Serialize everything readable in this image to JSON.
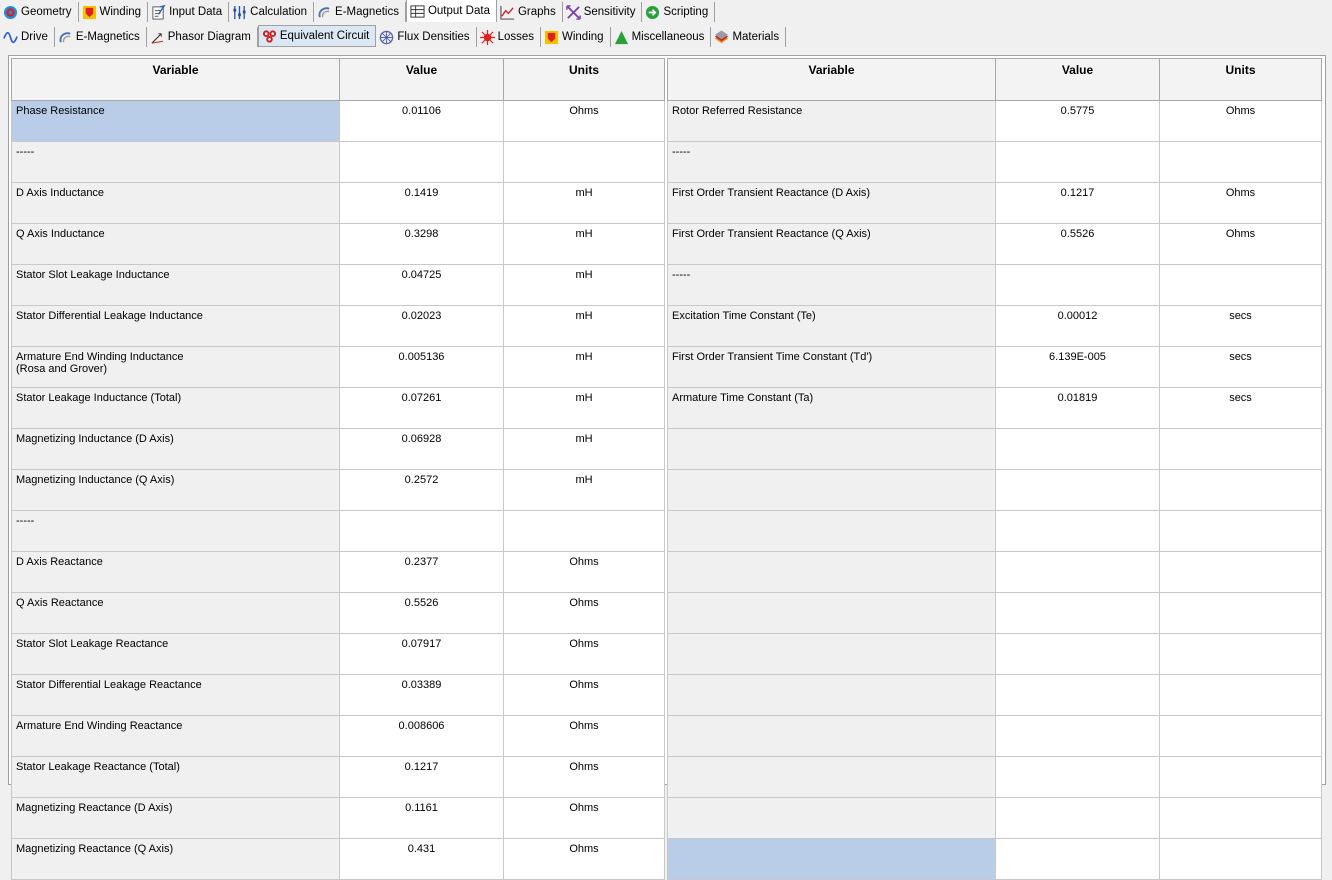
{
  "main_tabs": [
    {
      "label": "Geometry",
      "icon": "geometry-icon"
    },
    {
      "label": "Winding",
      "icon": "winding-icon"
    },
    {
      "label": "Input Data",
      "icon": "input-data-icon"
    },
    {
      "label": "Calculation",
      "icon": "calculation-icon"
    },
    {
      "label": "E-Magnetics",
      "icon": "e-magnetics-icon"
    },
    {
      "label": "Output Data",
      "icon": "output-data-icon",
      "active": true
    },
    {
      "label": "Graphs",
      "icon": "graphs-icon"
    },
    {
      "label": "Sensitivity",
      "icon": "sensitivity-icon"
    },
    {
      "label": "Scripting",
      "icon": "scripting-icon"
    }
  ],
  "sub_tabs": [
    {
      "label": "Drive",
      "icon": "drive-icon"
    },
    {
      "label": "E-Magnetics",
      "icon": "e-magnetics-icon"
    },
    {
      "label": "Phasor Diagram",
      "icon": "phasor-diagram-icon"
    },
    {
      "label": "Equivalent Circuit",
      "icon": "equivalent-circuit-icon",
      "active": true
    },
    {
      "label": "Flux Densities",
      "icon": "flux-densities-icon"
    },
    {
      "label": "Losses",
      "icon": "losses-icon"
    },
    {
      "label": "Winding",
      "icon": "winding-icon"
    },
    {
      "label": "Miscellaneous",
      "icon": "miscellaneous-icon"
    },
    {
      "label": "Materials",
      "icon": "materials-icon"
    }
  ],
  "left_table": {
    "headers": {
      "variable": "Variable",
      "value": "Value",
      "units": "Units"
    },
    "rows": [
      {
        "variable": "Phase Resistance",
        "value": "0.01106",
        "units": "Ohms",
        "selected": true
      },
      {
        "variable": "-----",
        "value": "",
        "units": ""
      },
      {
        "variable": "D Axis Inductance",
        "value": "0.1419",
        "units": "mH"
      },
      {
        "variable": "Q Axis Inductance",
        "value": "0.3298",
        "units": "mH"
      },
      {
        "variable": "Stator Slot Leakage Inductance",
        "value": "0.04725",
        "units": "mH"
      },
      {
        "variable": "Stator Differential Leakage Inductance",
        "value": "0.02023",
        "units": "mH"
      },
      {
        "variable": "Armature End Winding Inductance",
        "variable_line2": "(Rosa and Grover)",
        "value": "0.005136",
        "units": "mH"
      },
      {
        "variable": "Stator Leakage Inductance (Total)",
        "value": "0.07261",
        "units": "mH"
      },
      {
        "variable": "Magnetizing Inductance (D Axis)",
        "value": "0.06928",
        "units": "mH"
      },
      {
        "variable": "Magnetizing Inductance (Q Axis)",
        "value": "0.2572",
        "units": "mH"
      },
      {
        "variable": "-----",
        "value": "",
        "units": ""
      },
      {
        "variable": "D Axis Reactance",
        "value": "0.2377",
        "units": "Ohms"
      },
      {
        "variable": "Q Axis Reactance",
        "value": "0.5526",
        "units": "Ohms"
      },
      {
        "variable": "Stator Slot Leakage Reactance",
        "value": "0.07917",
        "units": "Ohms"
      },
      {
        "variable": "Stator Differential Leakage Reactance",
        "value": "0.03389",
        "units": "Ohms"
      },
      {
        "variable": "Armature End Winding Reactance",
        "value": "0.008606",
        "units": "Ohms"
      },
      {
        "variable": "Stator Leakage Reactance (Total)",
        "value": "0.1217",
        "units": "Ohms"
      },
      {
        "variable": "Magnetizing Reactance (D Axis)",
        "value": "0.1161",
        "units": "Ohms"
      },
      {
        "variable": "Magnetizing Reactance (Q Axis)",
        "value": "0.431",
        "units": "Ohms"
      }
    ]
  },
  "right_table": {
    "headers": {
      "variable": "Variable",
      "value": "Value",
      "units": "Units"
    },
    "rows": [
      {
        "variable": "Rotor Referred Resistance",
        "value": "0.5775",
        "units": "Ohms"
      },
      {
        "variable": "-----",
        "value": "",
        "units": ""
      },
      {
        "variable": "First Order Transient Reactance (D Axis)",
        "value": "0.1217",
        "units": "Ohms"
      },
      {
        "variable": "First Order Transient Reactance (Q Axis)",
        "value": "0.5526",
        "units": "Ohms"
      },
      {
        "variable": "-----",
        "value": "",
        "units": ""
      },
      {
        "variable": "Excitation Time Constant (Te)",
        "value": "0.00012",
        "units": "secs"
      },
      {
        "variable": "First Order Transient Time Constant (Td')",
        "value": "6.139E-005",
        "units": "secs"
      },
      {
        "variable": "Armature Time Constant (Ta)",
        "value": "0.01819",
        "units": "secs"
      },
      {
        "variable": "",
        "value": "",
        "units": ""
      },
      {
        "variable": "",
        "value": "",
        "units": ""
      },
      {
        "variable": "",
        "value": "",
        "units": ""
      },
      {
        "variable": "",
        "value": "",
        "units": ""
      },
      {
        "variable": "",
        "value": "",
        "units": ""
      },
      {
        "variable": "",
        "value": "",
        "units": ""
      },
      {
        "variable": "",
        "value": "",
        "units": ""
      },
      {
        "variable": "",
        "value": "",
        "units": ""
      },
      {
        "variable": "",
        "value": "",
        "units": ""
      },
      {
        "variable": "",
        "value": "",
        "units": ""
      },
      {
        "variable": "",
        "value": "",
        "units": "",
        "selected": true
      }
    ]
  }
}
